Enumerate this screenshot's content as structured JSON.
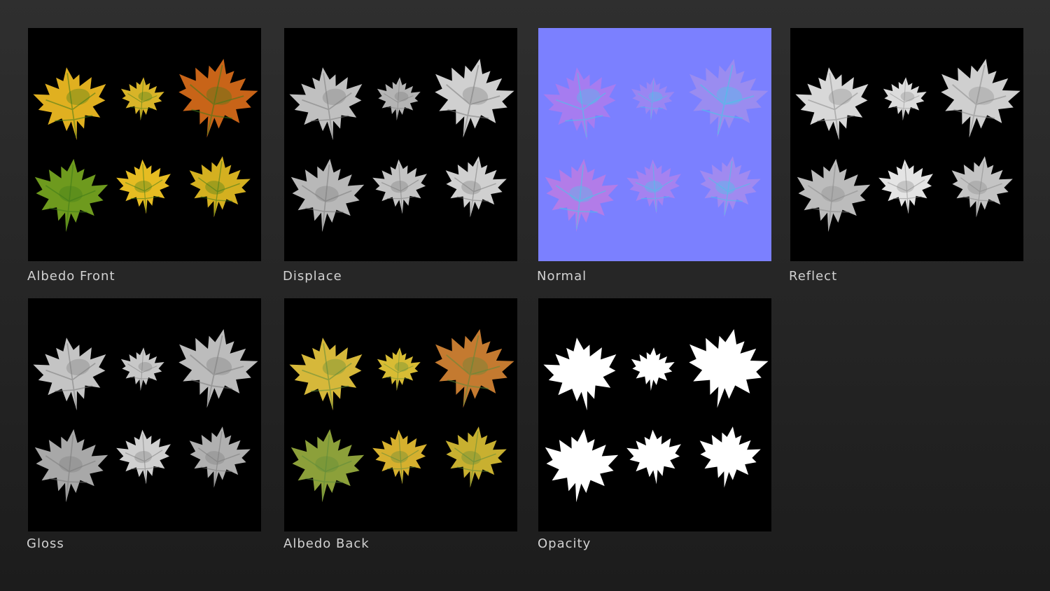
{
  "maps": [
    {
      "id": "albedo-front",
      "label": "Albedo Front",
      "background": "#000000",
      "fills": [
        "#e0b020",
        "#d8b428",
        "#c86418",
        "#6e9a1e",
        "#e6bc22",
        "#d4b020"
      ],
      "accent": "#3e7a1a"
    },
    {
      "id": "displace",
      "label": "Displace",
      "background": "#000000",
      "fills": [
        "#c0c0c0",
        "#b4b4b4",
        "#d0d0d0",
        "#b8b8b8",
        "#c4c4c4",
        "#d0d0d0"
      ],
      "accent": "#7a7a7a"
    },
    {
      "id": "normal",
      "label": "Normal",
      "background": "#7b80ff",
      "fills": [
        "#a67cf0",
        "#9a86f2",
        "#9a8cf0",
        "#b27ce8",
        "#a582f0",
        "#a08af0"
      ],
      "accent": "#46c8e8"
    },
    {
      "id": "reflect",
      "label": "Reflect",
      "background": "#000000",
      "fills": [
        "#d8d8d8",
        "#dcdcdc",
        "#cfcfcf",
        "#bcbcbc",
        "#e4e4e4",
        "#c4c4c4"
      ],
      "accent": "#8a8a8a"
    },
    {
      "id": "gloss",
      "label": "Gloss",
      "background": "#000000",
      "fills": [
        "#c4c4c4",
        "#c8c8c8",
        "#bcbcbc",
        "#a8a8a8",
        "#d0d0d0",
        "#b0b0b0"
      ],
      "accent": "#7a7a7a"
    },
    {
      "id": "albedo-back",
      "label": "Albedo Back",
      "background": "#000000",
      "fills": [
        "#d6b83a",
        "#d8bc34",
        "#c47a30",
        "#8ca03a",
        "#d6b02e",
        "#c8b030"
      ],
      "accent": "#5c8a3a"
    },
    {
      "id": "opacity",
      "label": "Opacity",
      "background": "#000000",
      "fills": [
        "#ffffff",
        "#ffffff",
        "#ffffff",
        "#ffffff",
        "#ffffff",
        "#ffffff"
      ],
      "accent": "#ffffff"
    }
  ]
}
